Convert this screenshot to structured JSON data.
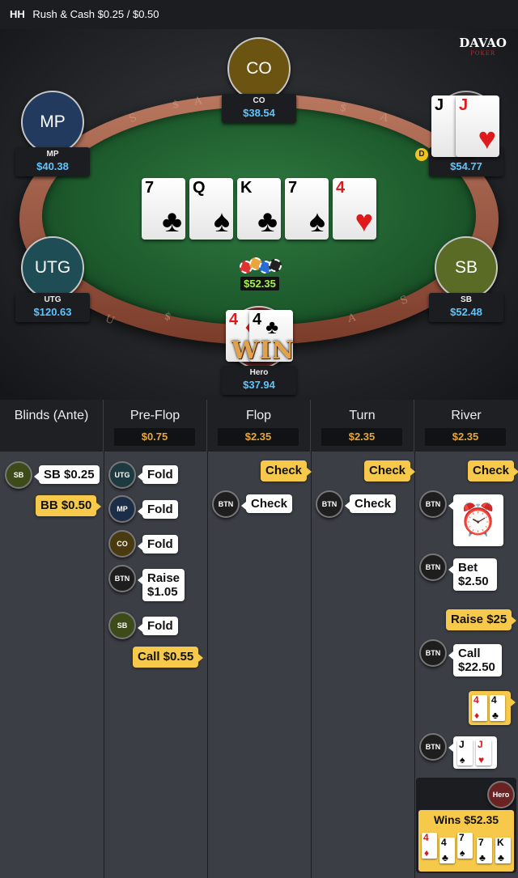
{
  "header": {
    "game_code": "HH",
    "title": "Rush & Cash $0.25 / $0.50"
  },
  "logo": {
    "line1": "DAVAO",
    "line2": "POKER"
  },
  "seats": {
    "co": {
      "avatar_label": "CO",
      "name": "CO",
      "stack": "$38.54",
      "color": "#6b5412"
    },
    "mp": {
      "avatar_label": "MP",
      "name": "MP",
      "stack": "$40.38",
      "color": "#223a5e"
    },
    "btn": {
      "name": "BTN",
      "stack": "$54.77"
    },
    "utg": {
      "avatar_label": "UTG",
      "name": "UTG",
      "stack": "$120.63",
      "color": "#1f4d55"
    },
    "sb": {
      "avatar_label": "SB",
      "name": "SB",
      "stack": "$52.48",
      "color": "#5a6b26"
    },
    "hero": {
      "name": "Hero",
      "stack": "$37.94"
    }
  },
  "dealer_button": "D",
  "board": [
    {
      "rank": "7",
      "suit": "♣"
    },
    {
      "rank": "Q",
      "suit": "♠"
    },
    {
      "rank": "K",
      "suit": "♣"
    },
    {
      "rank": "7",
      "suit": "♠"
    },
    {
      "rank": "4",
      "suit": "♥"
    }
  ],
  "btn_cards": [
    {
      "rank": "J",
      "suit": "♠"
    },
    {
      "rank": "J",
      "suit": "♥"
    }
  ],
  "hero_cards": [
    {
      "rank": "4",
      "suit": "♦"
    },
    {
      "rank": "4",
      "suit": "♣"
    }
  ],
  "win_overlay": "WIN",
  "pot": "$52.35",
  "history": {
    "columns": [
      {
        "title": "Blinds (Ante)",
        "value": ""
      },
      {
        "title": "Pre-Flop",
        "value": "$0.75"
      },
      {
        "title": "Flop",
        "value": "$2.35"
      },
      {
        "title": "Turn",
        "value": "$2.35"
      },
      {
        "title": "River",
        "value": "$2.35"
      }
    ],
    "blinds": {
      "sb_badge": "SB",
      "sb_text": "SB $0.25",
      "bb_text": "BB $0.50"
    },
    "preflop": {
      "utg_badge": "UTG",
      "utg_action": "Fold",
      "mp_badge": "MP",
      "mp_action": "Fold",
      "co_badge": "CO",
      "co_action": "Fold",
      "btn_badge": "BTN",
      "btn_action": "Raise $1.05",
      "sb_badge": "SB",
      "sb_action": "Fold",
      "hero_action": "Call $0.55"
    },
    "flop": {
      "hero_action": "Check",
      "btn_badge": "BTN",
      "btn_action": "Check"
    },
    "turn": {
      "hero_action": "Check",
      "btn_badge": "BTN",
      "btn_action": "Check"
    },
    "river": {
      "hero_check": "Check",
      "btn_badge": "BTN",
      "bet_action": "Bet $2.50",
      "hero_raise": "Raise $25",
      "call_action": "Call $22.50",
      "hero_badge": "Hero",
      "wins_text": "Wins $52.35"
    }
  }
}
